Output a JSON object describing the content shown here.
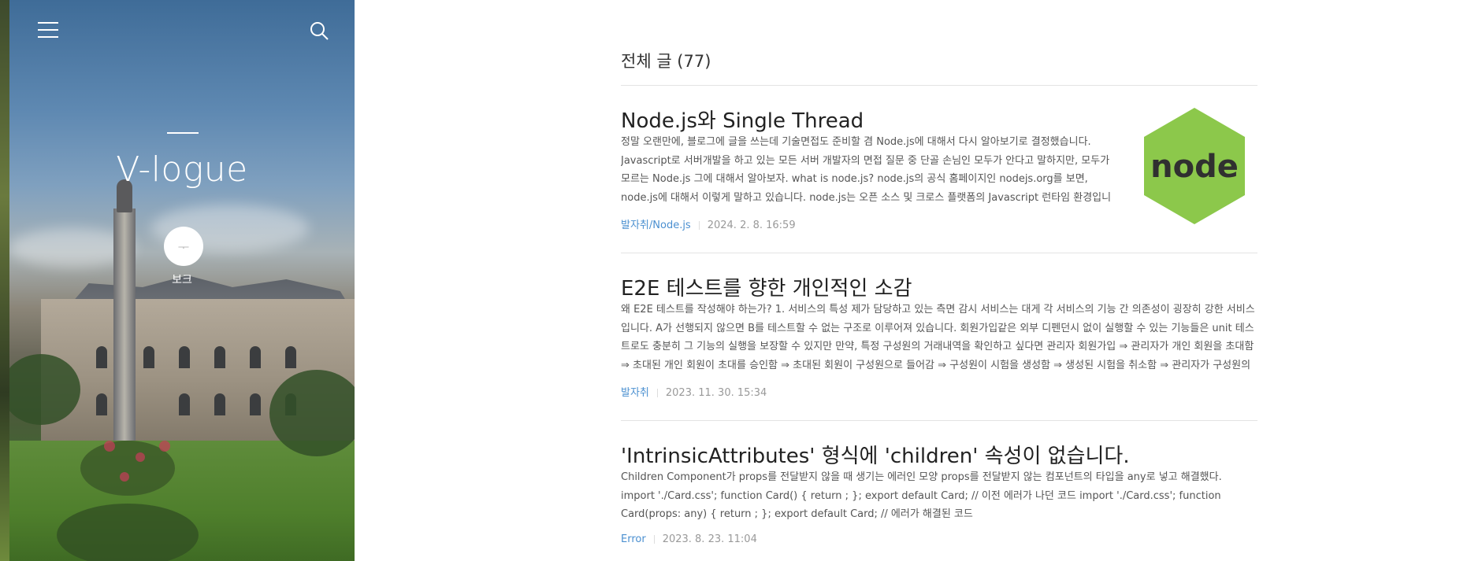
{
  "sidebar": {
    "blog_title": "V-logue",
    "profile_label": "보크",
    "profile_glyph": "ᅮ"
  },
  "main": {
    "heading": "전체 글 (77)",
    "posts": [
      {
        "title": "Node.js와 Single Thread",
        "excerpt": "정말 오랜만에, 블로그에 글을 쓰는데 기술면접도 준비할 겸 Node.js에 대해서 다시 알아보기로 결정했습니다. Javascript로 서버개발을 하고 있는 모든 서버 개발자의 면접 질문 중 단골 손님인 모두가 안다고 말하지만, 모두가 모르는 Node.js 그에 대해서 알아보자. what is node.js? node.js의 공식 홈페이지인 nodejs.org를 보면, node.js에 대해서 이렇게 말하고 있습니다. node.js는 오픈 소스 및 크로스 플랫폼의 Javascript 런타임 환경입니다. node.js는 브라우…",
        "category": "발자취/Node.js",
        "date": "2024. 2. 8. 16:59",
        "thumbnail_icon": "nodejs-logo"
      },
      {
        "title": "E2E 테스트를 향한 개인적인 소감",
        "excerpt": "왜 E2E 테스트를 작성해야 하는가? 1. 서비스의 특성 제가 담당하고 있는 측면 감시 서비스는 대게 각 서비스의 기능 간 의존성이 굉장히 강한 서비스입니다. A가 선행되지 않으면 B를 테스트할 수 없는 구조로 이루어져 있습니다. 회원가입같은 외부 디펜던시 없이 실행할 수 있는 기능들은 unit 테스트로도 충분히 그 기능의 실행을 보장할 수 있지만 만약, 특정 구성원의 거래내역을 확인하고 싶다면 관리자 회원가입 ⇒ 관리자가 개인 회원을 초대함 ⇒ 초대된 개인 회원이 초대를 승인함 ⇒ 초대된 회원이 구성원으로 들어감 ⇒ 구성원이 시험을 생성함 ⇒ 생성된 시험을 취소함 ⇒ 관리자가 구성원의 거래내역…",
        "category": "발자취",
        "date": "2023. 11. 30. 15:34"
      },
      {
        "title": "'IntrinsicAttributes' 형식에 'children' 속성이 없습니다.",
        "excerpt": "Children Component가 props를 전달받지 않을 때 생기는 에러인 모양 props를 전달받지 않는 컴포넌트의 타입을 any로 넣고 해결했다. import './Card.css'; function Card() { return ; }; export default Card; // 이전 에러가 나던 코드 import './Card.css'; function Card(props: any) { return ; }; export default Card; // 에러가 해결된 코드",
        "category": "Error",
        "date": "2023. 8. 23. 11:04"
      }
    ]
  },
  "colors": {
    "accent": "#4a8fd0",
    "node_green": "#8cc84b"
  }
}
